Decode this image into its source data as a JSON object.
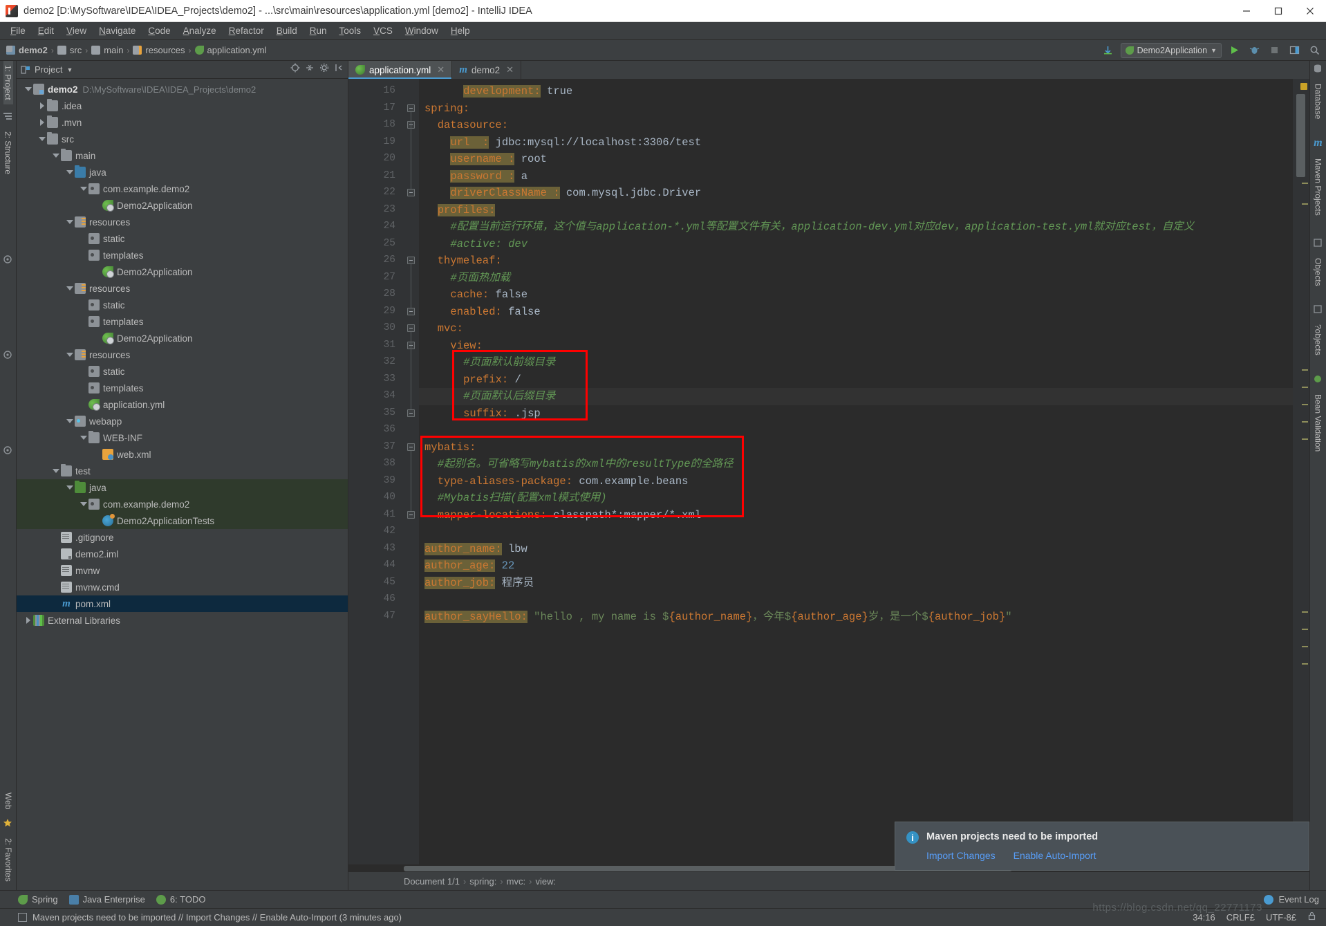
{
  "window": {
    "title": "demo2 [D:\\MySoftware\\IDEA\\IDEA_Projects\\demo2] - ...\\src\\main\\resources\\application.yml [demo2] - IntelliJ IDEA",
    "minimize": "─",
    "maximize": "☐",
    "close": "✕"
  },
  "menubar": {
    "items": [
      "File",
      "Edit",
      "View",
      "Navigate",
      "Code",
      "Analyze",
      "Refactor",
      "Build",
      "Run",
      "Tools",
      "VCS",
      "Window",
      "Help"
    ]
  },
  "navbar": {
    "crumbs": [
      "demo2",
      "src",
      "main",
      "resources",
      "application.yml"
    ],
    "run_config": "Demo2Application",
    "run_icon": "play-icon",
    "debug_icon": "debug-icon",
    "stop_icon": "stop-icon",
    "search_icon": "search-icon",
    "update_icon": "update-project-icon"
  },
  "left_rail": {
    "items": [
      "1: Project",
      "2: Structure",
      "2: Favorites",
      "Web"
    ]
  },
  "right_rail": {
    "items": [
      "Database",
      "Maven Projects",
      "Objects",
      "?objects",
      "Bean Validation"
    ]
  },
  "project": {
    "header_title": "Project",
    "header_icon": "project-view-icon",
    "tree": [
      {
        "depth": 0,
        "arrow": "down",
        "icon": "t-mod",
        "label": "demo2",
        "bold": true,
        "path": "D:\\MySoftware\\IDEA\\IDEA_Projects\\demo2"
      },
      {
        "depth": 1,
        "arrow": "right",
        "icon": "t-folder",
        "label": ".idea"
      },
      {
        "depth": 1,
        "arrow": "right",
        "icon": "t-folder",
        "label": ".mvn"
      },
      {
        "depth": 1,
        "arrow": "down",
        "icon": "t-folder",
        "label": "src"
      },
      {
        "depth": 2,
        "arrow": "down",
        "icon": "t-folder",
        "label": "main"
      },
      {
        "depth": 3,
        "arrow": "down",
        "icon": "t-src",
        "label": "java"
      },
      {
        "depth": 4,
        "arrow": "down",
        "icon": "t-pkg",
        "label": "com.example.demo2"
      },
      {
        "depth": 5,
        "arrow": "none",
        "icon": "t-spring",
        "label": "Demo2Application"
      },
      {
        "depth": 3,
        "arrow": "down",
        "icon": "t-res",
        "label": "resources"
      },
      {
        "depth": 4,
        "arrow": "none",
        "icon": "t-pkg",
        "label": "static"
      },
      {
        "depth": 4,
        "arrow": "none",
        "icon": "t-pkg",
        "label": "templates"
      },
      {
        "depth": 5,
        "arrow": "none",
        "icon": "t-spring",
        "label": "Demo2Application"
      },
      {
        "depth": 3,
        "arrow": "down",
        "icon": "t-res",
        "label": "resources"
      },
      {
        "depth": 4,
        "arrow": "none",
        "icon": "t-pkg",
        "label": "static"
      },
      {
        "depth": 4,
        "arrow": "none",
        "icon": "t-pkg",
        "label": "templates"
      },
      {
        "depth": 5,
        "arrow": "none",
        "icon": "t-spring",
        "label": "Demo2Application"
      },
      {
        "depth": 3,
        "arrow": "down",
        "icon": "t-res",
        "label": "resources"
      },
      {
        "depth": 4,
        "arrow": "none",
        "icon": "t-pkg",
        "label": "static"
      },
      {
        "depth": 4,
        "arrow": "none",
        "icon": "t-pkg",
        "label": "templates"
      },
      {
        "depth": 4,
        "arrow": "none",
        "icon": "t-spring",
        "label": "application.yml"
      },
      {
        "depth": 3,
        "arrow": "down",
        "icon": "t-web",
        "label": "webapp"
      },
      {
        "depth": 4,
        "arrow": "down",
        "icon": "t-folder",
        "label": "WEB-INF"
      },
      {
        "depth": 5,
        "arrow": "none",
        "icon": "t-xml",
        "label": "web.xml"
      },
      {
        "depth": 2,
        "arrow": "down",
        "icon": "t-folder",
        "label": "test"
      },
      {
        "depth": 3,
        "arrow": "down",
        "icon": "t-test",
        "label": "java",
        "sel": "green"
      },
      {
        "depth": 4,
        "arrow": "down",
        "icon": "t-pkg",
        "label": "com.example.demo2",
        "sel": "green"
      },
      {
        "depth": 5,
        "arrow": "none",
        "icon": "t-test-class",
        "label": "Demo2ApplicationTests",
        "sel": "green"
      },
      {
        "depth": 2,
        "arrow": "none",
        "icon": "t-file",
        "label": ".gitignore"
      },
      {
        "depth": 2,
        "arrow": "none",
        "icon": "t-iml",
        "label": "demo2.iml"
      },
      {
        "depth": 2,
        "arrow": "none",
        "icon": "t-file",
        "label": "mvnw"
      },
      {
        "depth": 2,
        "arrow": "none",
        "icon": "t-file",
        "label": "mvnw.cmd"
      },
      {
        "depth": 2,
        "arrow": "none",
        "icon": "t-maven",
        "label": "pom.xml",
        "sel": "blue"
      },
      {
        "depth": 0,
        "arrow": "right",
        "icon": "t-lib",
        "label": "External Libraries"
      }
    ]
  },
  "tabs": [
    {
      "label": "application.yml",
      "icon": "spring-yaml-icon",
      "active": true
    },
    {
      "label": "demo2",
      "icon": "maven-icon",
      "active": false
    }
  ],
  "editor": {
    "first_line": 16,
    "lines": [
      {
        "n": 16,
        "indent": 6,
        "tokens": [
          {
            "t": "development:",
            "c": "kwb"
          },
          {
            "t": " ",
            "c": "val"
          },
          {
            "t": "true",
            "c": "val"
          }
        ]
      },
      {
        "n": 17,
        "indent": 0,
        "fold": true,
        "tokens": [
          {
            "t": "spring:",
            "c": "kw"
          }
        ]
      },
      {
        "n": 18,
        "indent": 2,
        "fold": true,
        "tokens": [
          {
            "t": "datasource:",
            "c": "kw"
          }
        ]
      },
      {
        "n": 19,
        "indent": 4,
        "tokens": [
          {
            "t": "url  :",
            "c": "kwb"
          },
          {
            "t": " ",
            "c": "val"
          },
          {
            "t": "jdbc:mysql://localhost:3306/test",
            "c": "val"
          }
        ]
      },
      {
        "n": 20,
        "indent": 4,
        "tokens": [
          {
            "t": "username :",
            "c": "kwb"
          },
          {
            "t": " ",
            "c": "val"
          },
          {
            "t": "root",
            "c": "val"
          }
        ]
      },
      {
        "n": 21,
        "indent": 4,
        "tokens": [
          {
            "t": "password :",
            "c": "kwb"
          },
          {
            "t": " ",
            "c": "val"
          },
          {
            "t": "a",
            "c": "val"
          }
        ]
      },
      {
        "n": 22,
        "indent": 4,
        "fold": true,
        "tokens": [
          {
            "t": "driverClassName :",
            "c": "kwb"
          },
          {
            "t": " ",
            "c": "val"
          },
          {
            "t": "com.mysql.jdbc.Driver",
            "c": "val"
          }
        ]
      },
      {
        "n": 23,
        "indent": 2,
        "tokens": [
          {
            "t": "profiles:",
            "c": "kwb"
          }
        ]
      },
      {
        "n": 24,
        "indent": 4,
        "tokens": [
          {
            "t": "#配置当前运行环境，这个值与application-*.yml等配置文件有关，application-dev.yml对应dev，application-test.yml就对应test，自定义",
            "c": "cmt"
          }
        ]
      },
      {
        "n": 25,
        "indent": 4,
        "tokens": [
          {
            "t": "#active: dev",
            "c": "cmt"
          }
        ]
      },
      {
        "n": 26,
        "indent": 2,
        "fold": true,
        "tokens": [
          {
            "t": "thymeleaf:",
            "c": "kw"
          }
        ]
      },
      {
        "n": 27,
        "indent": 4,
        "tokens": [
          {
            "t": "#页面热加载",
            "c": "cmt"
          }
        ]
      },
      {
        "n": 28,
        "indent": 4,
        "tokens": [
          {
            "t": "cache:",
            "c": "kw"
          },
          {
            "t": " ",
            "c": "val"
          },
          {
            "t": "false",
            "c": "val"
          }
        ]
      },
      {
        "n": 29,
        "indent": 4,
        "fold": true,
        "tokens": [
          {
            "t": "enabled:",
            "c": "kw"
          },
          {
            "t": " ",
            "c": "val"
          },
          {
            "t": "false",
            "c": "val"
          }
        ]
      },
      {
        "n": 30,
        "indent": 2,
        "fold": true,
        "tokens": [
          {
            "t": "mvc:",
            "c": "kw"
          }
        ]
      },
      {
        "n": 31,
        "indent": 4,
        "fold": true,
        "tokens": [
          {
            "t": "view:",
            "c": "kw"
          }
        ]
      },
      {
        "n": 32,
        "indent": 6,
        "tokens": [
          {
            "t": "#页面默认前缀目录",
            "c": "cmt"
          }
        ]
      },
      {
        "n": 33,
        "indent": 6,
        "tokens": [
          {
            "t": "prefix:",
            "c": "kw"
          },
          {
            "t": " ",
            "c": "val"
          },
          {
            "t": "/",
            "c": "val"
          }
        ]
      },
      {
        "n": 34,
        "indent": 6,
        "highlight": true,
        "tokens": [
          {
            "t": "#页面默认后缀目录",
            "c": "cmt"
          }
        ]
      },
      {
        "n": 35,
        "indent": 6,
        "fold": true,
        "tokens": [
          {
            "t": "suffix:",
            "c": "kw"
          },
          {
            "t": " ",
            "c": "val"
          },
          {
            "t": ".jsp",
            "c": "val"
          }
        ]
      },
      {
        "n": 36,
        "indent": 0,
        "tokens": []
      },
      {
        "n": 37,
        "indent": 0,
        "fold": true,
        "tokens": [
          {
            "t": "mybatis:",
            "c": "kw"
          }
        ]
      },
      {
        "n": 38,
        "indent": 2,
        "tokens": [
          {
            "t": "#起别名。可省略写mybatis的xml中的resultType的全路径",
            "c": "cmt"
          }
        ]
      },
      {
        "n": 39,
        "indent": 2,
        "tokens": [
          {
            "t": "type-aliases-package:",
            "c": "kw"
          },
          {
            "t": " ",
            "c": "val"
          },
          {
            "t": "com.example.beans",
            "c": "val"
          }
        ]
      },
      {
        "n": 40,
        "indent": 2,
        "tokens": [
          {
            "t": "#Mybatis扫描(配置xml模式使用)",
            "c": "cmt"
          }
        ]
      },
      {
        "n": 41,
        "indent": 2,
        "fold": true,
        "tokens": [
          {
            "t": "mapper-locations:",
            "c": "kw"
          },
          {
            "t": " ",
            "c": "val"
          },
          {
            "t": "classpath*:mapper/*.xml",
            "c": "val"
          }
        ]
      },
      {
        "n": 42,
        "indent": 0,
        "tokens": []
      },
      {
        "n": 43,
        "indent": 0,
        "tokens": [
          {
            "t": "author_name:",
            "c": "kwb"
          },
          {
            "t": " ",
            "c": "val"
          },
          {
            "t": "lbw",
            "c": "val"
          }
        ]
      },
      {
        "n": 44,
        "indent": 0,
        "tokens": [
          {
            "t": "author_age:",
            "c": "kwb"
          },
          {
            "t": " ",
            "c": "val"
          },
          {
            "t": "22",
            "c": "num"
          }
        ]
      },
      {
        "n": 45,
        "indent": 0,
        "tokens": [
          {
            "t": "author_job:",
            "c": "kwb"
          },
          {
            "t": " ",
            "c": "val"
          },
          {
            "t": "程序员",
            "c": "val"
          }
        ]
      },
      {
        "n": 46,
        "indent": 0,
        "tokens": []
      },
      {
        "n": 47,
        "indent": 0,
        "tokens": [
          {
            "t": "author_sayHello:",
            "c": "kwb"
          },
          {
            "t": " ",
            "c": "val"
          },
          {
            "t": "\"hello , my name is $",
            "c": "str"
          },
          {
            "t": "{author_name}",
            "c": "kw"
          },
          {
            "t": "，今年$",
            "c": "str"
          },
          {
            "t": "{author_age}",
            "c": "kw"
          },
          {
            "t": "岁，是一个$",
            "c": "str"
          },
          {
            "t": "{author_job}",
            "c": "kw"
          },
          {
            "t": "\"",
            "c": "str"
          }
        ]
      }
    ]
  },
  "breadcrumb": {
    "items": [
      "Document 1/1",
      "spring:",
      "mvc:",
      "view:"
    ],
    "separator": "›"
  },
  "bottombar": {
    "items": [
      {
        "label": "Spring",
        "icon": "spring-leaf-icon"
      },
      {
        "label": "Java Enterprise",
        "icon": "java-enterprise-icon"
      },
      {
        "label": "6: TODO",
        "icon": "todo-icon"
      }
    ],
    "event_log": "Event Log",
    "event_log_icon": "event-log-icon"
  },
  "statusbar": {
    "message": "Maven projects need to be imported // Import Changes // Enable Auto-Import (3 minutes ago)",
    "caret": "34:16",
    "line_sep": "CRLF£",
    "encoding": "UTF-8£",
    "lock_icon": "lock-icon"
  },
  "notification": {
    "title": "Maven projects need to be imported",
    "icon": "info-icon",
    "links": [
      "Import Changes",
      "Enable Auto-Import"
    ]
  },
  "watermark": "https://blog.csdn.net/qq_22771173",
  "colors": {
    "accent": "#4a9bd1",
    "marker_red": "#ff0000",
    "keyword": "#cc7832",
    "comment": "#629755",
    "string": "#6a8759",
    "value": "#a9b7c6",
    "number": "#6897bb",
    "editor_bg": "#2b2b2b",
    "panel_bg": "#3c3f41",
    "link": "#589df6"
  }
}
